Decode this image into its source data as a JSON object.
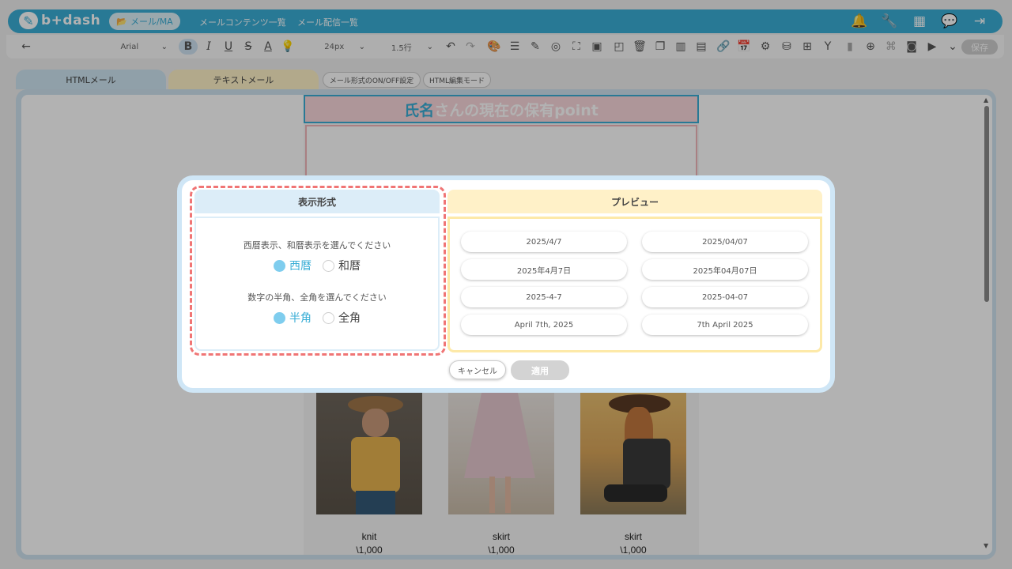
{
  "nav": {
    "logo_mark": "✎",
    "logo_text": "b+dash",
    "active_label": "メール/MA",
    "links": [
      "メールコンテンツ一覧",
      "メール配信一覧"
    ],
    "icons": [
      "bell-icon",
      "wrench-icon",
      "grid-icon",
      "chat-icon",
      "logout-icon"
    ]
  },
  "toolbar": {
    "back": "←",
    "font": "Arial",
    "size": "24px",
    "line_height": "1.5行",
    "save_label": "保存"
  },
  "tabs": {
    "html": "HTMLメール",
    "text": "テキストメール",
    "toggle_format": "メール形式のON/OFF設定",
    "html_edit": "HTML編集モード"
  },
  "email": {
    "title_var": "氏名",
    "title_rest": "さんの現在の保有point",
    "products": [
      {
        "name": "knit",
        "price": "\\1,000"
      },
      {
        "name": "skirt",
        "price": "\\1,000"
      },
      {
        "name": "skirt",
        "price": "\\1,000"
      }
    ]
  },
  "modal": {
    "format_title": "表示形式",
    "q1": "西暦表示、和暦表示を選んでください",
    "q1_options": [
      "西暦",
      "和暦"
    ],
    "q1_selected": "西暦",
    "q2": "数字の半角、全角を選んでください",
    "q2_options": [
      "半角",
      "全角"
    ],
    "q2_selected": "半角",
    "preview_title": "プレビュー",
    "previews": [
      "2025/4/7",
      "2025/04/07",
      "2025年4月7日",
      "2025年04月07日",
      "2025-4-7",
      "2025-04-07",
      "April 7th, 2025",
      "7th April 2025"
    ],
    "cancel_label": "キャンセル",
    "apply_label": "適用"
  },
  "colors": {
    "brand": "#3aaed6",
    "highlight": "#f07575",
    "format_header": "#dcedf8",
    "preview_header": "#fff1c8"
  }
}
